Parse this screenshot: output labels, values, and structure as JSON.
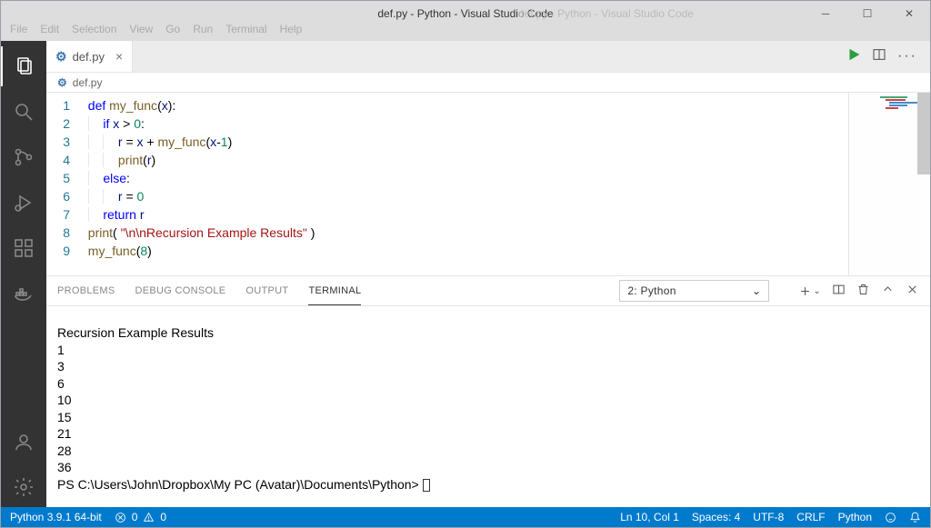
{
  "window": {
    "title": "def.py - Python - Visual Studio Code",
    "ghost_title": "def.py - Python - Visual Studio Code"
  },
  "menu": {
    "items": [
      "File",
      "Edit",
      "Selection",
      "View",
      "Go",
      "Run",
      "Terminal",
      "Help"
    ]
  },
  "tabs": {
    "open": [
      {
        "label": "def.py",
        "icon": "python-icon",
        "active": true
      }
    ]
  },
  "breadcrumb": {
    "label": "def.py",
    "icon": "python-icon"
  },
  "code": {
    "lines": [
      {
        "n": 1,
        "tokens": [
          [
            "kw",
            "def "
          ],
          [
            "fn",
            "my_func"
          ],
          [
            "op",
            "("
          ],
          [
            "v",
            "x"
          ],
          [
            "op",
            "):"
          ]
        ],
        "indent": 0
      },
      {
        "n": 2,
        "tokens": [
          [
            "kw",
            "if"
          ],
          [
            "op",
            " "
          ],
          [
            "v",
            "x"
          ],
          [
            "op",
            " > "
          ],
          [
            "num",
            "0"
          ],
          [
            "op",
            ":"
          ]
        ],
        "indent": 1
      },
      {
        "n": 3,
        "tokens": [
          [
            "v",
            "r"
          ],
          [
            "op",
            " = "
          ],
          [
            "v",
            "x"
          ],
          [
            "op",
            " + "
          ],
          [
            "fn",
            "my_func"
          ],
          [
            "op",
            "("
          ],
          [
            "v",
            "x"
          ],
          [
            "op",
            "-"
          ],
          [
            "num",
            "1"
          ],
          [
            "op",
            ")"
          ]
        ],
        "indent": 2
      },
      {
        "n": 4,
        "tokens": [
          [
            "fn",
            "print"
          ],
          [
            "op",
            "("
          ],
          [
            "v",
            "r"
          ],
          [
            "op",
            ")"
          ]
        ],
        "indent": 2
      },
      {
        "n": 5,
        "tokens": [
          [
            "kw",
            "else"
          ],
          [
            "op",
            ":"
          ]
        ],
        "indent": 1
      },
      {
        "n": 6,
        "tokens": [
          [
            "v",
            "r"
          ],
          [
            "op",
            " = "
          ],
          [
            "num",
            "0"
          ]
        ],
        "indent": 2
      },
      {
        "n": 7,
        "tokens": [
          [
            "kw",
            "return"
          ],
          [
            "op",
            " "
          ],
          [
            "v",
            "r"
          ]
        ],
        "indent": 1
      },
      {
        "n": 8,
        "tokens": [
          [
            "fn",
            "print"
          ],
          [
            "op",
            "( "
          ],
          [
            "str",
            "\"\\n\\nRecursion Example Results\""
          ],
          [
            "op",
            " )"
          ]
        ],
        "indent": 0,
        "noguide": true
      },
      {
        "n": 9,
        "tokens": [
          [
            "fn",
            "my_func"
          ],
          [
            "op",
            "("
          ],
          [
            "num",
            "8"
          ],
          [
            "op",
            ")"
          ]
        ],
        "indent": 0,
        "noguide": true
      }
    ]
  },
  "panel": {
    "tabs": [
      "PROBLEMS",
      "DEBUG CONSOLE",
      "OUTPUT",
      "TERMINAL"
    ],
    "active_tab": "TERMINAL",
    "terminal_select": "2: Python",
    "terminal_lines": [
      "Recursion Example Results",
      "1",
      "3",
      "6",
      "10",
      "15",
      "21",
      "28",
      "36"
    ],
    "prompt": "PS C:\\Users\\John\\Dropbox\\My PC (Avatar)\\Documents\\Python> "
  },
  "status": {
    "interpreter": "Python 3.9.1 64-bit",
    "errors": "0",
    "warnings": "0",
    "cursor": "Ln 10, Col 1",
    "spaces": "Spaces: 4",
    "encoding": "UTF-8",
    "eol": "CRLF",
    "lang": "Python"
  },
  "colors": {
    "accent": "#007acc"
  }
}
